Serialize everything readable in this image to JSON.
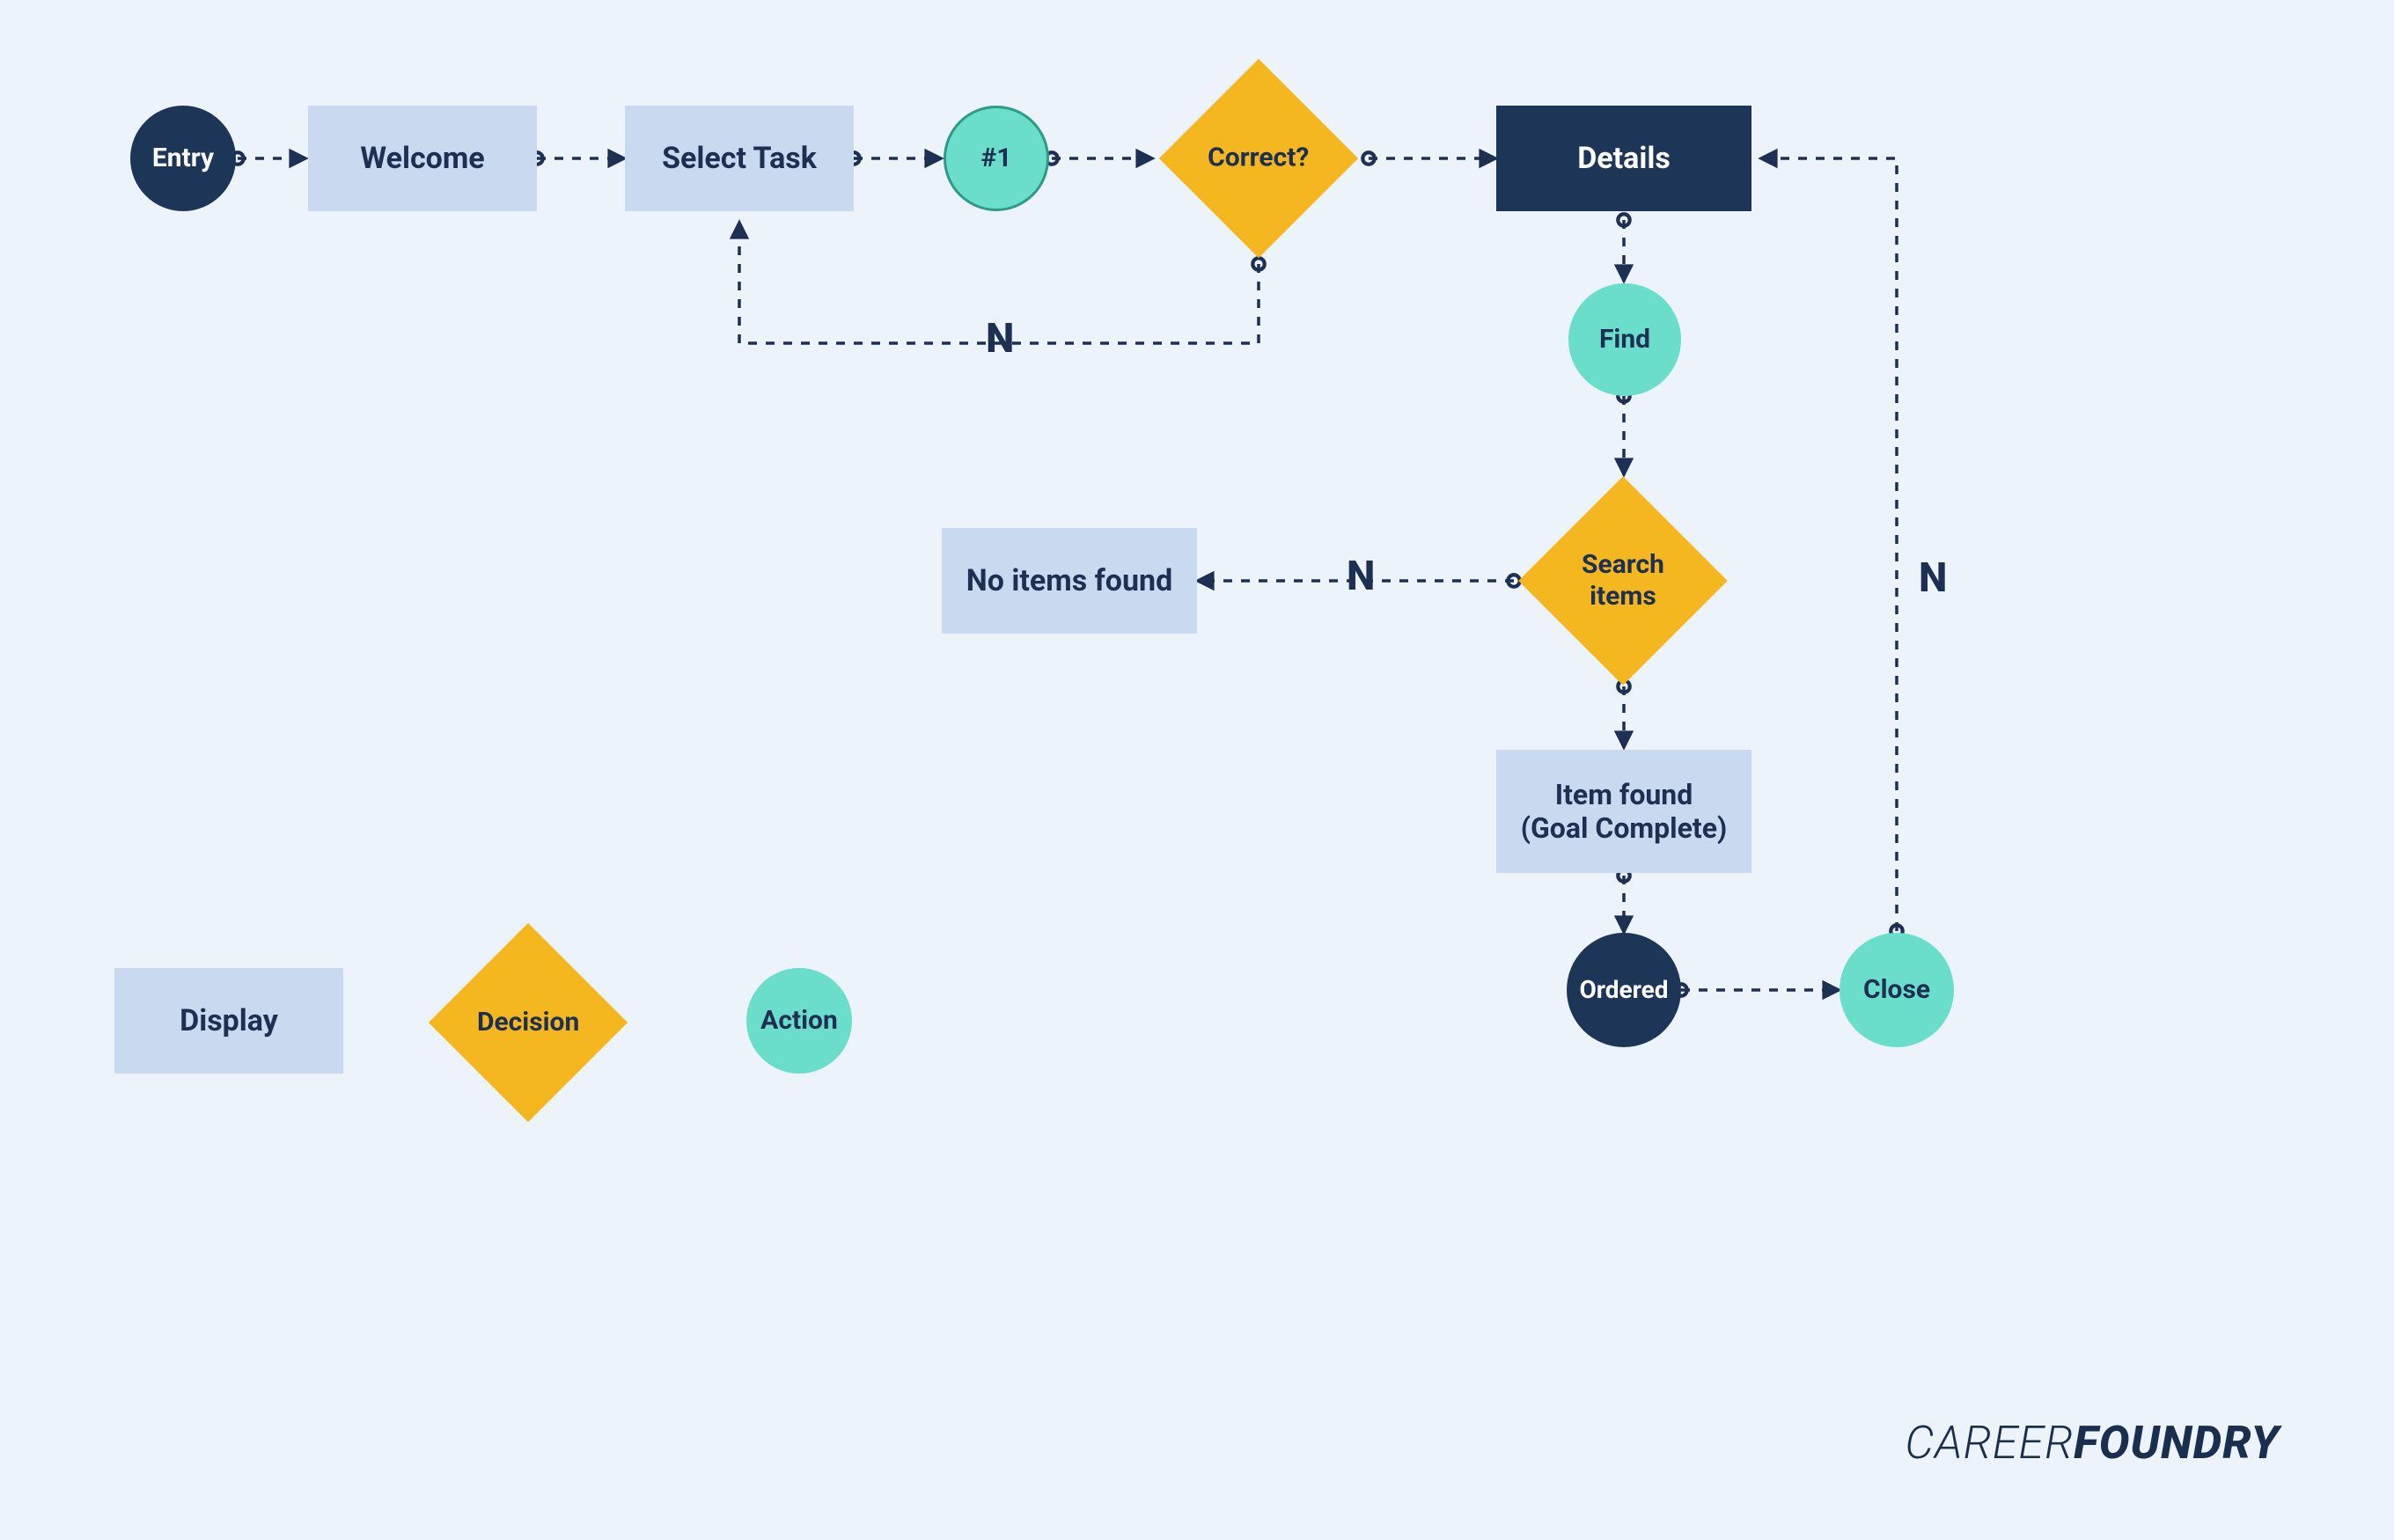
{
  "diagram": {
    "nodes": {
      "entry": {
        "label": "Entry",
        "type": "entry-circle"
      },
      "welcome": {
        "label": "Welcome",
        "type": "display"
      },
      "select_task": {
        "label": "Select Task",
        "type": "display"
      },
      "hash1": {
        "label": "#1",
        "type": "action"
      },
      "correct": {
        "label": "Correct?",
        "type": "decision"
      },
      "details": {
        "label": "Details",
        "type": "display-dark"
      },
      "find": {
        "label": "Find",
        "type": "action"
      },
      "search_items": {
        "label": "Search\nitems",
        "type": "decision"
      },
      "no_items": {
        "label": "No items found",
        "type": "display"
      },
      "item_found": {
        "label": "Item found\n(Goal Complete)",
        "type": "display"
      },
      "ordered": {
        "label": "Ordered",
        "type": "entry-circle"
      },
      "close": {
        "label": "Close",
        "type": "action"
      }
    },
    "edges": [
      {
        "from": "entry",
        "to": "welcome"
      },
      {
        "from": "welcome",
        "to": "select_task"
      },
      {
        "from": "select_task",
        "to": "hash1"
      },
      {
        "from": "hash1",
        "to": "correct"
      },
      {
        "from": "correct",
        "to": "details"
      },
      {
        "from": "correct",
        "to": "select_task",
        "label": "N"
      },
      {
        "from": "details",
        "to": "find"
      },
      {
        "from": "find",
        "to": "search_items"
      },
      {
        "from": "search_items",
        "to": "no_items",
        "label": "N"
      },
      {
        "from": "search_items",
        "to": "item_found"
      },
      {
        "from": "item_found",
        "to": "ordered"
      },
      {
        "from": "ordered",
        "to": "close"
      },
      {
        "from": "close",
        "to": "details",
        "label": "N"
      }
    ],
    "legend": {
      "display": "Display",
      "decision": "Decision",
      "action": "Action"
    },
    "edge_labels": {
      "n": "N"
    },
    "brand": {
      "part1": "CAREER",
      "part2": "FOUNDRY"
    },
    "colors": {
      "background": "#ecf3fb",
      "navy": "#1d3557",
      "lightblue": "#c8d9f0",
      "teal": "#6addcb",
      "gold": "#f5b71f"
    }
  }
}
